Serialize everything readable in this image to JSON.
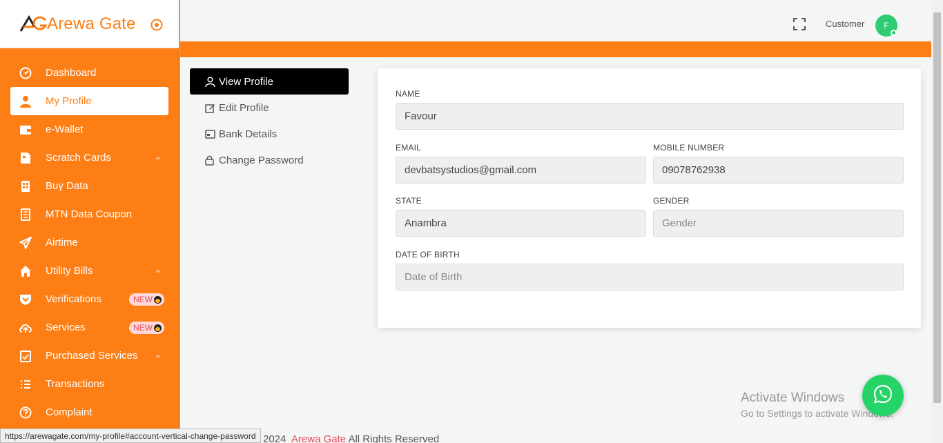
{
  "brand": {
    "name": "Arewa Gate",
    "accent": "#fd7e14"
  },
  "sidebar": {
    "items": [
      {
        "label": "Dashboard",
        "icon": "dashboard-icon"
      },
      {
        "label": "My Profile",
        "icon": "user-icon",
        "active": true
      },
      {
        "label": "e-Wallet",
        "icon": "wallet-icon"
      },
      {
        "label": "Scratch Cards",
        "icon": "card-icon",
        "expandable": true
      },
      {
        "label": "Buy Data",
        "icon": "data-icon"
      },
      {
        "label": "MTN Data Coupon",
        "icon": "coupon-icon"
      },
      {
        "label": "Airtime",
        "icon": "send-icon"
      },
      {
        "label": "Utility Bills",
        "icon": "home-icon",
        "expandable": true
      },
      {
        "label": "Verifications",
        "icon": "shield-icon",
        "badge": "NEW"
      },
      {
        "label": "Services",
        "icon": "cloud-upload-icon",
        "badge": "NEW"
      },
      {
        "label": "Purchased Services",
        "icon": "clipboard-check-icon",
        "expandable": true
      },
      {
        "label": "Transactions",
        "icon": "list-icon"
      },
      {
        "label": "Complaint",
        "icon": "help-icon"
      }
    ]
  },
  "header": {
    "role": "Customer",
    "avatar_initial": "F"
  },
  "profile_tabs": [
    {
      "label": "View Profile",
      "icon": "user-icon",
      "active": true
    },
    {
      "label": "Edit Profile",
      "icon": "edit-icon"
    },
    {
      "label": "Bank Details",
      "icon": "id-card-icon"
    },
    {
      "label": "Change Password",
      "icon": "lock-icon"
    }
  ],
  "form": {
    "name": {
      "label": "NAME",
      "value": "Favour"
    },
    "email": {
      "label": "EMAIL",
      "value": "devbatsystudios@gmail.com"
    },
    "mobile": {
      "label": "MOBILE NUMBER",
      "value": "09078762938"
    },
    "state": {
      "label": "STATE",
      "value": "Anambra"
    },
    "gender": {
      "label": "GENDER",
      "placeholder": "Gender"
    },
    "dob": {
      "label": "DATE OF BIRTH",
      "placeholder": "Date of Birth"
    }
  },
  "footer": {
    "year": "2024",
    "brand": "Arewa Gate",
    "rights": "All Rights Reserved"
  },
  "watermark": {
    "line1": "Activate Windows",
    "line2": "Go to Settings to activate Windows."
  },
  "statusbar": {
    "url": "https://arewagate.com/my-profile#account-vertical-change-password"
  }
}
